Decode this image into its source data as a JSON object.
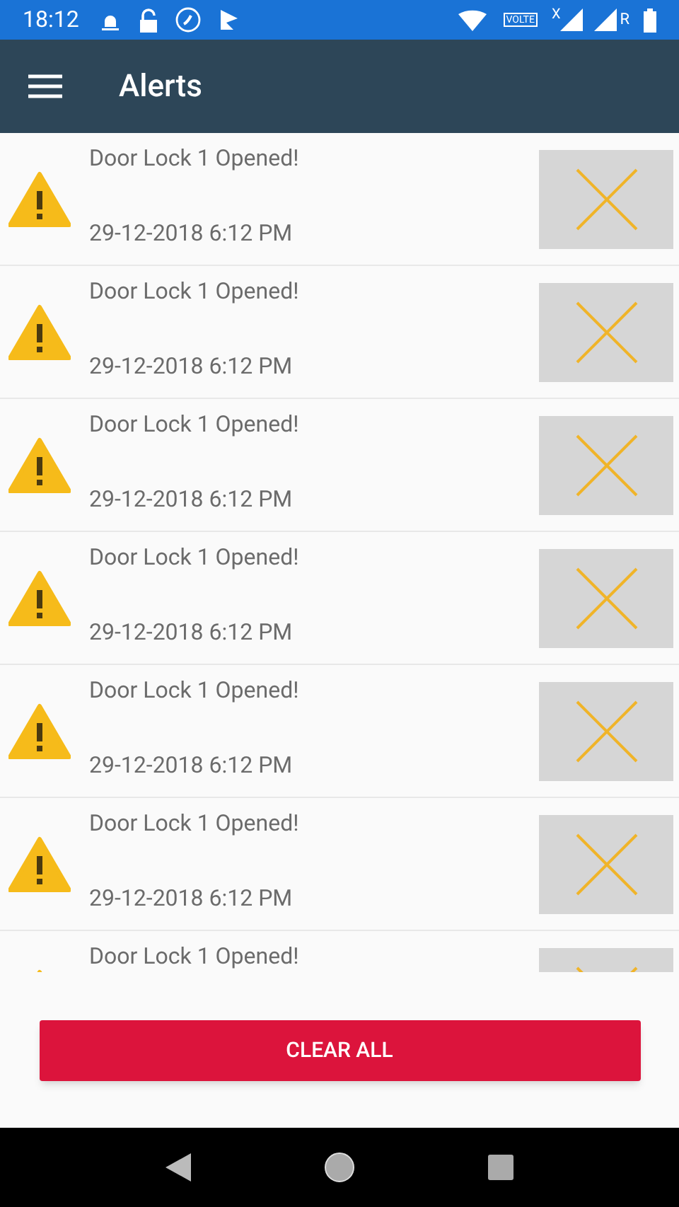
{
  "status_bar": {
    "time": "18:12",
    "volte_label": "VOLTE",
    "sim_label": "R",
    "roaming_mark": "X"
  },
  "toolbar": {
    "title": "Alerts"
  },
  "alerts": [
    {
      "title": "Door Lock 1 Opened!",
      "time": "29-12-2018 6:12 PM"
    },
    {
      "title": "Door Lock 1 Opened!",
      "time": "29-12-2018 6:12 PM"
    },
    {
      "title": "Door Lock 1 Opened!",
      "time": "29-12-2018 6:12 PM"
    },
    {
      "title": "Door Lock 1 Opened!",
      "time": "29-12-2018 6:12 PM"
    },
    {
      "title": "Door Lock 1 Opened!",
      "time": "29-12-2018 6:12 PM"
    },
    {
      "title": "Door Lock 1 Opened!",
      "time": "29-12-2018 6:12 PM"
    },
    {
      "title": "Door Lock 1 Opened!"
    }
  ],
  "clear_button": {
    "label": "CLEAR ALL"
  }
}
